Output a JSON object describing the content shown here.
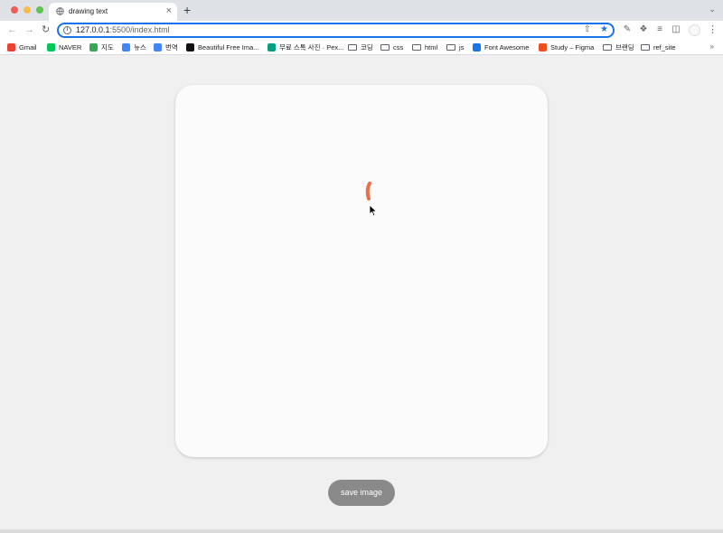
{
  "browser": {
    "tab_title": "drawing text",
    "new_tab": "+",
    "tab_close": "×",
    "url_host": "127.0.0.1",
    "url_rest": ":5500/index.html",
    "bookmarks": [
      {
        "label": "Gmail",
        "icon": "gmail-icon",
        "color": "#ea4335"
      },
      {
        "label": "NAVER",
        "icon": "naver-icon",
        "color": "#03c75a"
      },
      {
        "label": "지도",
        "icon": "maps-icon",
        "color": "#34a853"
      },
      {
        "label": "뉴스",
        "icon": "news-icon",
        "color": "#4285f4"
      },
      {
        "label": "번역",
        "icon": "translate-icon",
        "color": "#4285f4"
      },
      {
        "label": "Beautiful Free Ima...",
        "icon": "unsplash-icon",
        "color": "#111111"
      },
      {
        "label": "무료 스톡 사진 · Pex...",
        "icon": "pexels-icon",
        "color": "#05a081"
      },
      {
        "label": "코딩",
        "icon": "folder-icon"
      },
      {
        "label": "css",
        "icon": "folder-icon"
      },
      {
        "label": "html",
        "icon": "folder-icon"
      },
      {
        "label": "js",
        "icon": "folder-icon"
      },
      {
        "label": "Font Awesome",
        "icon": "flag-icon",
        "color": "#1a73e8"
      },
      {
        "label": "Study – Figma",
        "icon": "figma-icon",
        "color": "#f24e1e"
      },
      {
        "label": "브랜딩",
        "icon": "folder-icon"
      },
      {
        "label": "ref_site",
        "icon": "folder-icon"
      }
    ],
    "bookmarks_more": "»"
  },
  "app": {
    "save_button_label": "save image",
    "stroke_color": "#e8704a",
    "canvas_background": "#fbfbfb",
    "button_color": "#8a8a8a"
  }
}
